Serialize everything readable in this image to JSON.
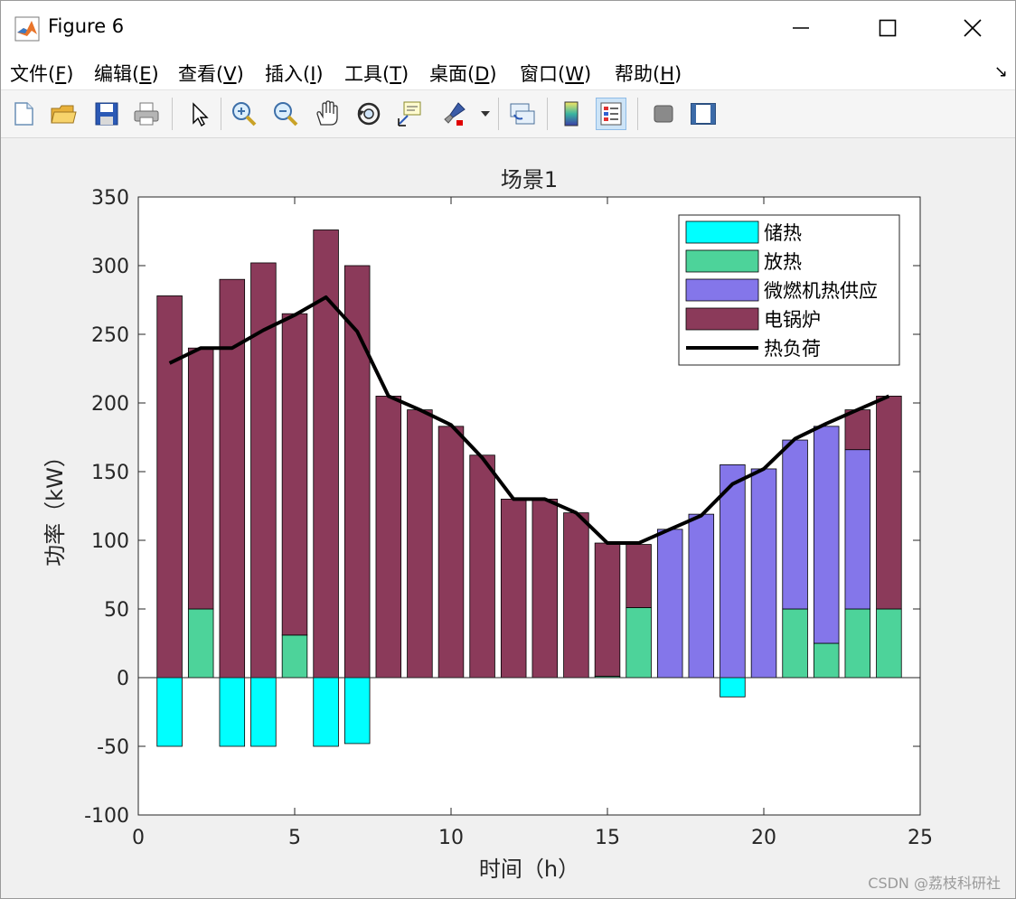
{
  "window": {
    "title": "Figure 6"
  },
  "menu": [
    "文件(F)",
    "编辑(E)",
    "查看(V)",
    "插入(I)",
    "工具(T)",
    "桌面(D)",
    "窗口(W)",
    "帮助(H)"
  ],
  "menu_keys": [
    "F",
    "E",
    "V",
    "I",
    "T",
    "D",
    "W",
    "H"
  ],
  "toolbar": [
    "new-file-icon",
    "open-folder-icon",
    "save-icon",
    "print-icon",
    "select-pointer-icon",
    "zoom-in-icon",
    "zoom-out-icon",
    "pan-hand-icon",
    "rotate-3d-icon",
    "data-cursor-icon",
    "brush-icon",
    "link-plot-icon",
    "colorbar-icon",
    "legend-icon",
    "hide-plot-tools-icon",
    "show-plot-tools-icon"
  ],
  "watermark": "CSDN @荔枝科研社",
  "colors": {
    "storage": "#00ffff",
    "release": "#4dd39a",
    "chp": "#8476ea",
    "boiler": "#8b3a5a",
    "load": "#000000"
  },
  "chart_data": {
    "type": "bar",
    "title": "场景1",
    "xlabel": "时间（h）",
    "ylabel": "功率（kW）",
    "xlim": [
      0,
      25
    ],
    "ylim": [
      -100,
      350
    ],
    "xticks": [
      0,
      5,
      10,
      15,
      20,
      25
    ],
    "yticks": [
      -100,
      -50,
      0,
      50,
      100,
      150,
      200,
      250,
      300,
      350
    ],
    "legend_position": "top-right",
    "x": [
      1,
      2,
      3,
      4,
      5,
      6,
      7,
      8,
      9,
      10,
      11,
      12,
      13,
      14,
      15,
      16,
      17,
      18,
      19,
      20,
      21,
      22,
      23,
      24
    ],
    "series": [
      {
        "name": "储热",
        "key": "storage",
        "values": [
          -50,
          0,
          -50,
          -50,
          0,
          -50,
          -48,
          0,
          0,
          0,
          0,
          0,
          0,
          0,
          0,
          0,
          0,
          0,
          -14,
          0,
          0,
          0,
          0,
          0
        ]
      },
      {
        "name": "放热",
        "key": "release",
        "values": [
          0,
          50,
          0,
          0,
          31,
          0,
          0,
          0,
          0,
          0,
          0,
          0,
          0,
          0,
          1,
          51,
          0,
          0,
          0,
          0,
          50,
          25,
          50,
          50
        ]
      },
      {
        "name": "微燃机热供应",
        "key": "chp",
        "values": [
          0,
          0,
          0,
          0,
          0,
          0,
          0,
          0,
          0,
          0,
          0,
          0,
          0,
          0,
          0,
          0,
          108,
          119,
          155,
          152,
          123,
          158,
          116,
          0
        ]
      },
      {
        "name": "电锅炉",
        "key": "boiler",
        "values": [
          278,
          190,
          290,
          302,
          234,
          326,
          300,
          205,
          195,
          183,
          162,
          130,
          130,
          120,
          97,
          46,
          0,
          0,
          0,
          0,
          0,
          0,
          29,
          155
        ]
      },
      {
        "name": "热负荷",
        "key": "load",
        "type": "line",
        "values": [
          229,
          240,
          240,
          253,
          264,
          277,
          252,
          205,
          195,
          184,
          160,
          130,
          130,
          120,
          98,
          98,
          108,
          118,
          141,
          152,
          174,
          185,
          195,
          205
        ]
      }
    ]
  }
}
